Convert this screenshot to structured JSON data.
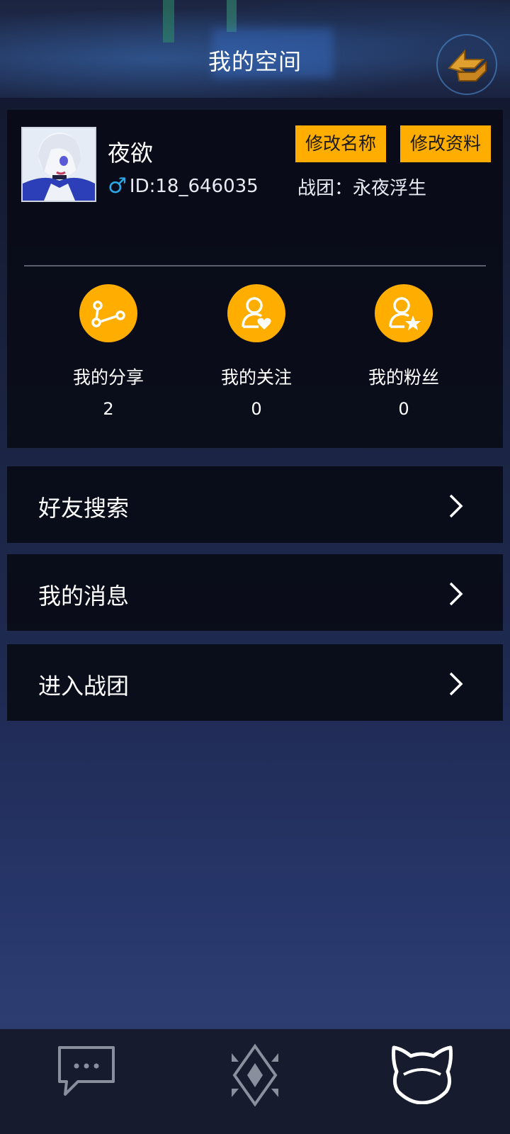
{
  "header": {
    "title": "我的空间"
  },
  "profile": {
    "nickname": "夜欲",
    "gender_symbol": "♂",
    "id_text": "ID:18_646035",
    "team_text": "战团：永夜浮生",
    "rename_button": "修改名称",
    "edit_profile_button": "修改资料"
  },
  "stats": [
    {
      "label": "我的分享",
      "count": "2"
    },
    {
      "label": "我的关注",
      "count": "0"
    },
    {
      "label": "我的粉丝",
      "count": "0"
    }
  ],
  "menu": [
    {
      "label": "好友搜索"
    },
    {
      "label": "我的消息"
    },
    {
      "label": "进入战团"
    }
  ],
  "colors": {
    "accent": "#ffae00",
    "gender": "#2aa8e8",
    "card_bg": "#080a14"
  },
  "icons": {
    "back": "back-arrow-icon",
    "share": "share-icon",
    "follow": "heart-user-icon",
    "fans": "star-user-icon",
    "chat": "chat-icon",
    "center": "diamond-icon",
    "me": "cat-head-icon"
  }
}
